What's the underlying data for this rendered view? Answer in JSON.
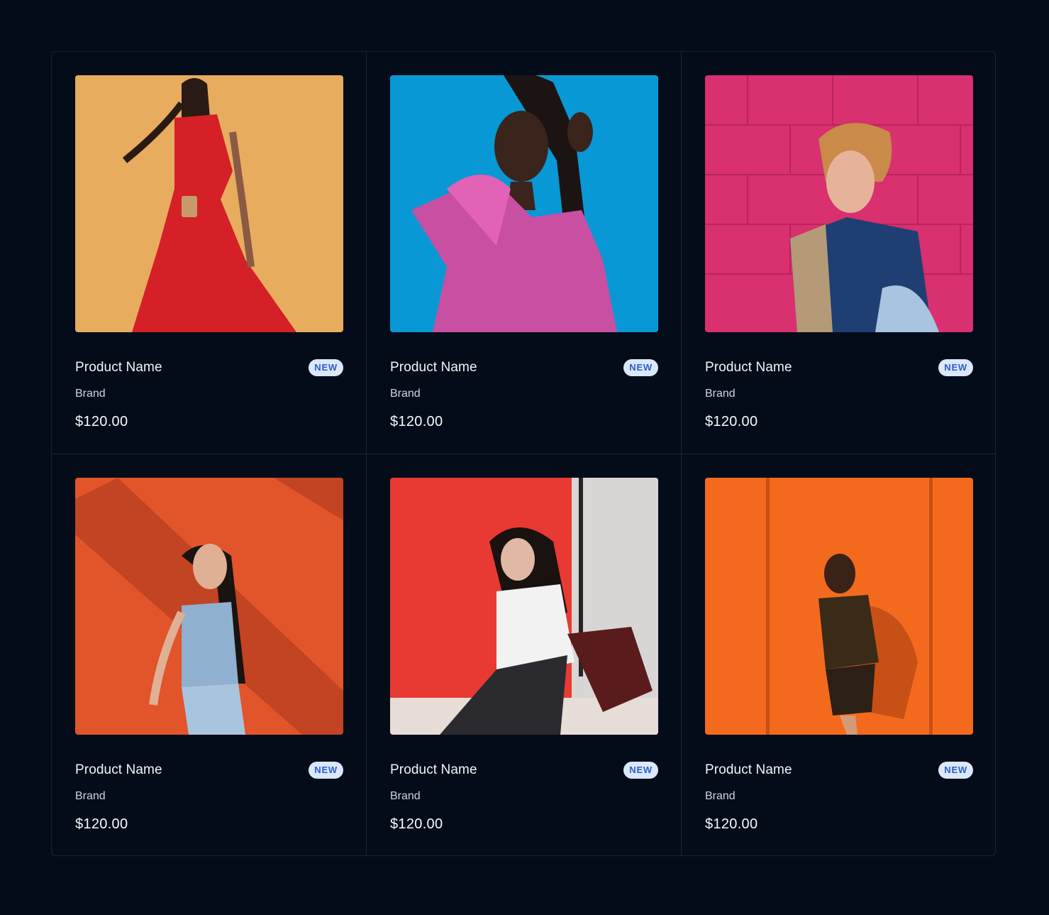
{
  "products": [
    {
      "name": "Product Name",
      "brand": "Brand",
      "price": "$120.00",
      "badge": "NEW",
      "image": "model-red-dress-on-yellow",
      "bg": "#e8ac5e"
    },
    {
      "name": "Product Name",
      "brand": "Brand",
      "price": "$120.00",
      "badge": "NEW",
      "image": "model-pink-blouse-on-blue",
      "bg": "#0998d6"
    },
    {
      "name": "Product Name",
      "brand": "Brand",
      "price": "$120.00",
      "badge": "NEW",
      "image": "model-jacket-on-pink-wall",
      "bg": "#d9306f"
    },
    {
      "name": "Product Name",
      "brand": "Brand",
      "price": "$120.00",
      "badge": "NEW",
      "image": "model-denim-on-orange-wall",
      "bg": "#e2542a"
    },
    {
      "name": "Product Name",
      "brand": "Brand",
      "price": "$120.00",
      "badge": "NEW",
      "image": "model-white-shirt-on-red-backdrop",
      "bg": "#e83a32"
    },
    {
      "name": "Product Name",
      "brand": "Brand",
      "price": "$120.00",
      "badge": "NEW",
      "image": "model-dark-outfit-on-orange-wall",
      "bg": "#f36a1e"
    }
  ]
}
